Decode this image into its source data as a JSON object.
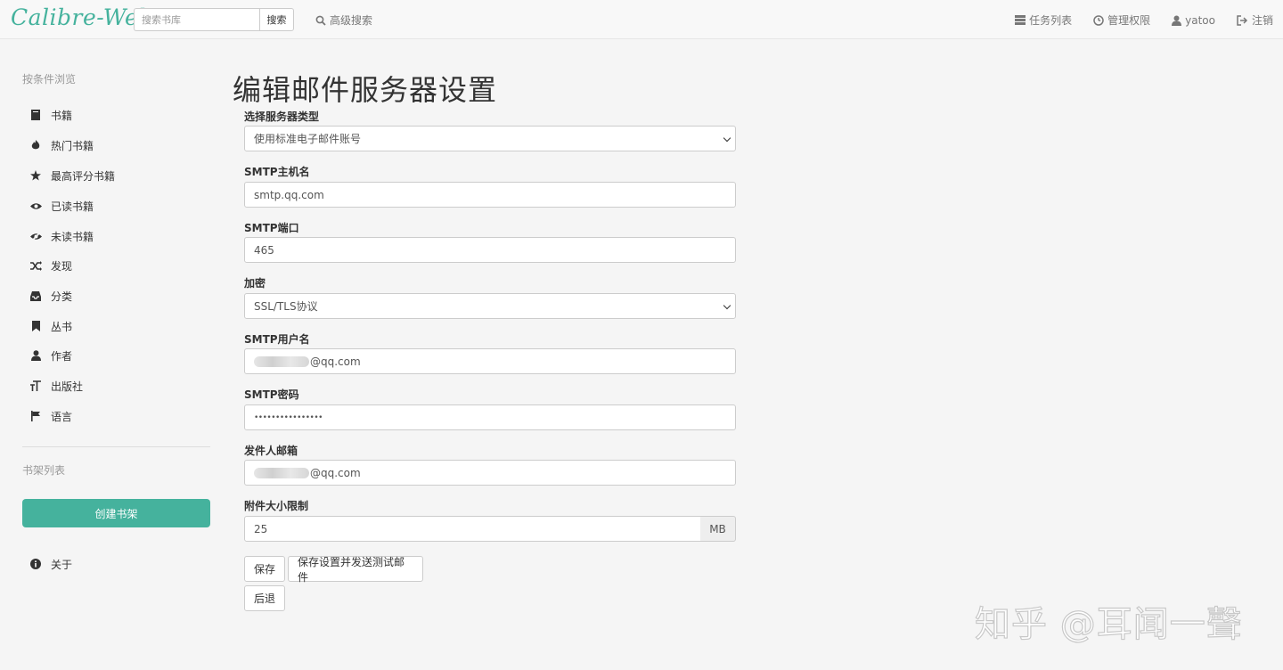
{
  "app": {
    "brand": "Calibre-Web"
  },
  "navbar": {
    "search_placeholder": "搜索书库",
    "search_button": "搜索",
    "advanced_search": "高级搜索",
    "right": [
      {
        "label": "任务列表",
        "icon": "tasks-icon"
      },
      {
        "label": "管理权限",
        "icon": "dashboard-icon"
      },
      {
        "label": "yatoo",
        "icon": "user-icon"
      },
      {
        "label": "注销",
        "icon": "logout-icon"
      }
    ]
  },
  "sidebar": {
    "browse_heading": "按条件浏览",
    "items": [
      {
        "label": "书籍",
        "icon": "book-icon"
      },
      {
        "label": "热门书籍",
        "icon": "fire-icon"
      },
      {
        "label": "最高评分书籍",
        "icon": "star-icon"
      },
      {
        "label": "已读书籍",
        "icon": "eye-icon"
      },
      {
        "label": "未读书籍",
        "icon": "eye-slash-icon"
      },
      {
        "label": "发现",
        "icon": "random-icon"
      },
      {
        "label": "分类",
        "icon": "inbox-icon"
      },
      {
        "label": "丛书",
        "icon": "bookmark-icon"
      },
      {
        "label": "作者",
        "icon": "user-icon"
      },
      {
        "label": "出版社",
        "icon": "text-size-icon"
      },
      {
        "label": "语言",
        "icon": "flag-icon"
      }
    ],
    "shelves_heading": "书架列表",
    "create_shelf": "创建书架",
    "about": "关于"
  },
  "form": {
    "title": "编辑邮件服务器设置",
    "server_type_label": "选择服务器类型",
    "server_type_value": "使用标准电子邮件账号",
    "host_label": "SMTP主机名",
    "host_value": "smtp.qq.com",
    "port_label": "SMTP端口",
    "port_value": "465",
    "encryption_label": "加密",
    "encryption_value": "SSL/TLS协议",
    "username_label": "SMTP用户名",
    "username_value": "@qq.com",
    "password_label": "SMTP密码",
    "password_value": "••••••••••••••••",
    "sender_label": "发件人邮箱",
    "sender_value": "@qq.com",
    "size_label": "附件大小限制",
    "size_value": "25",
    "size_unit": "MB",
    "save_button": "保存",
    "save_test_button": "保存设置并发送测试邮件",
    "back_button": "后退"
  },
  "watermark": "知乎 @耳闻一聲",
  "colors": {
    "accent": "#45b29d"
  }
}
